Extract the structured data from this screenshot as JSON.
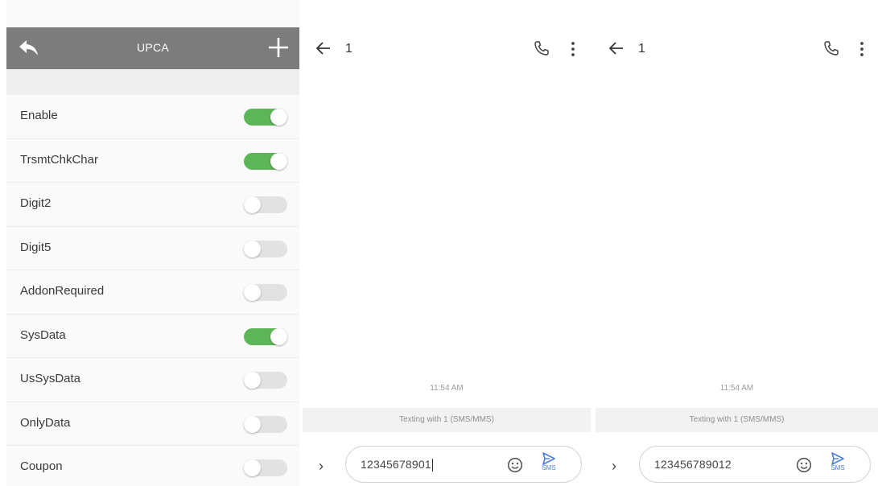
{
  "settings": {
    "title": "UPCA",
    "items": [
      {
        "label": "Enable",
        "on": true
      },
      {
        "label": "TrsmtChkChar",
        "on": true
      },
      {
        "label": "Digit2",
        "on": false
      },
      {
        "label": "Digit5",
        "on": false
      },
      {
        "label": "AddonRequired",
        "on": false
      },
      {
        "label": "SysData",
        "on": true
      },
      {
        "label": "UsSysData",
        "on": false
      },
      {
        "label": "OnlyData",
        "on": false
      },
      {
        "label": "Coupon",
        "on": false
      }
    ]
  },
  "conversations": [
    {
      "title": "1",
      "time": "11:54 AM",
      "status": "Texting with 1 (SMS/MMS)",
      "input": "12345678901",
      "send_label": "SMS"
    },
    {
      "title": "1",
      "time": "11:54 AM",
      "status": "Texting with 1 (SMS/MMS)",
      "input": "123456789012",
      "send_label": "SMS"
    }
  ],
  "colors": {
    "header": "#7c7c7c",
    "toggle_on": "#5cb557",
    "toggle_off": "#e2e2e2",
    "accent": "#4a7fd4"
  },
  "icons": [
    "reply-back-icon",
    "plus-icon",
    "back-arrow-icon",
    "phone-icon",
    "more-vert-icon",
    "chevron-right-icon",
    "emoji-icon",
    "send-icon"
  ]
}
